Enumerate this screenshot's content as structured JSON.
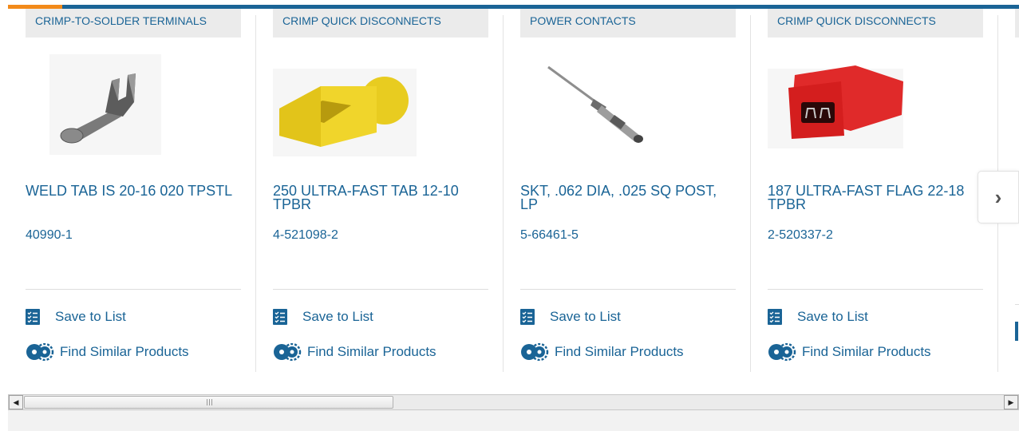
{
  "colors": {
    "accent": "#f28a1a",
    "brand_blue": "#1a6496"
  },
  "products": [
    {
      "category": "CRIMP-TO-SOLDER TERMINALS",
      "title": "WELD TAB IS 20-16 020 TPSTL",
      "part": "40990-1",
      "image": "weld-tab-terminal-image",
      "save": "Save to List",
      "similar": "Find Similar Products"
    },
    {
      "category": "CRIMP QUICK DISCONNECTS",
      "title": "250 ULTRA-FAST TAB 12-10 TPBR",
      "part": "4-521098-2",
      "image": "yellow-quick-disconnect-image",
      "save": "Save to List",
      "similar": "Find Similar Products"
    },
    {
      "category": "POWER CONTACTS",
      "title": "SKT, .062 DIA, .025 SQ POST, LP",
      "part": "5-66461-5",
      "image": "socket-contact-image",
      "save": "Save to List",
      "similar": "Find Similar Products"
    },
    {
      "category": "CRIMP QUICK DISCONNECTS",
      "title": "187 ULTRA-FAST FLAG 22-18 TPBR",
      "part": "2-520337-2",
      "image": "red-flag-disconnect-image",
      "save": "Save to List",
      "similar": "Find Similar Products"
    }
  ],
  "carousel": {
    "next_icon": "chevron-right-icon",
    "next_glyph": "›"
  },
  "scrollbar": {
    "left_arrow": "◀",
    "right_arrow": "▶"
  }
}
